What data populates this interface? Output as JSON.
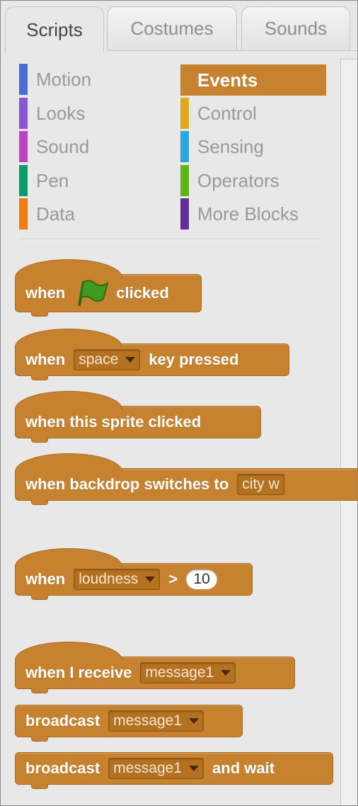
{
  "tabs": [
    {
      "label": "Scripts",
      "active": true
    },
    {
      "label": "Costumes",
      "active": false
    },
    {
      "label": "Sounds",
      "active": false
    }
  ],
  "categories": {
    "left": [
      {
        "label": "Motion",
        "color": "#4a6cd4"
      },
      {
        "label": "Looks",
        "color": "#8a55d7"
      },
      {
        "label": "Sound",
        "color": "#bb42c3"
      },
      {
        "label": "Pen",
        "color": "#0e9a6c"
      },
      {
        "label": "Data",
        "color": "#ee7d16"
      }
    ],
    "right": [
      {
        "label": "Events",
        "color": "#c88330",
        "selected": true
      },
      {
        "label": "Control",
        "color": "#e1a91a"
      },
      {
        "label": "Sensing",
        "color": "#2ca5e2"
      },
      {
        "label": "Operators",
        "color": "#5cb712"
      },
      {
        "label": "More Blocks",
        "color": "#632d99"
      }
    ]
  },
  "blocks": {
    "flag_clicked": {
      "when": "when",
      "clicked": "clicked"
    },
    "key_pressed": {
      "when": "when",
      "key": "space",
      "rest": "key pressed"
    },
    "sprite_clicked": {
      "text": "when this sprite clicked"
    },
    "backdrop": {
      "text": "when backdrop switches to",
      "value": "city w"
    },
    "sensor": {
      "when": "when",
      "sensor": "loudness",
      "op": ">",
      "value": "10"
    },
    "receive": {
      "text": "when I receive",
      "message": "message1"
    },
    "broadcast": {
      "text": "broadcast",
      "message": "message1"
    },
    "broadcast_wait": {
      "text": "broadcast",
      "message": "message1",
      "rest": "and wait"
    }
  },
  "colors": {
    "events": "#c6822f",
    "flag": "#3f9a1f"
  }
}
